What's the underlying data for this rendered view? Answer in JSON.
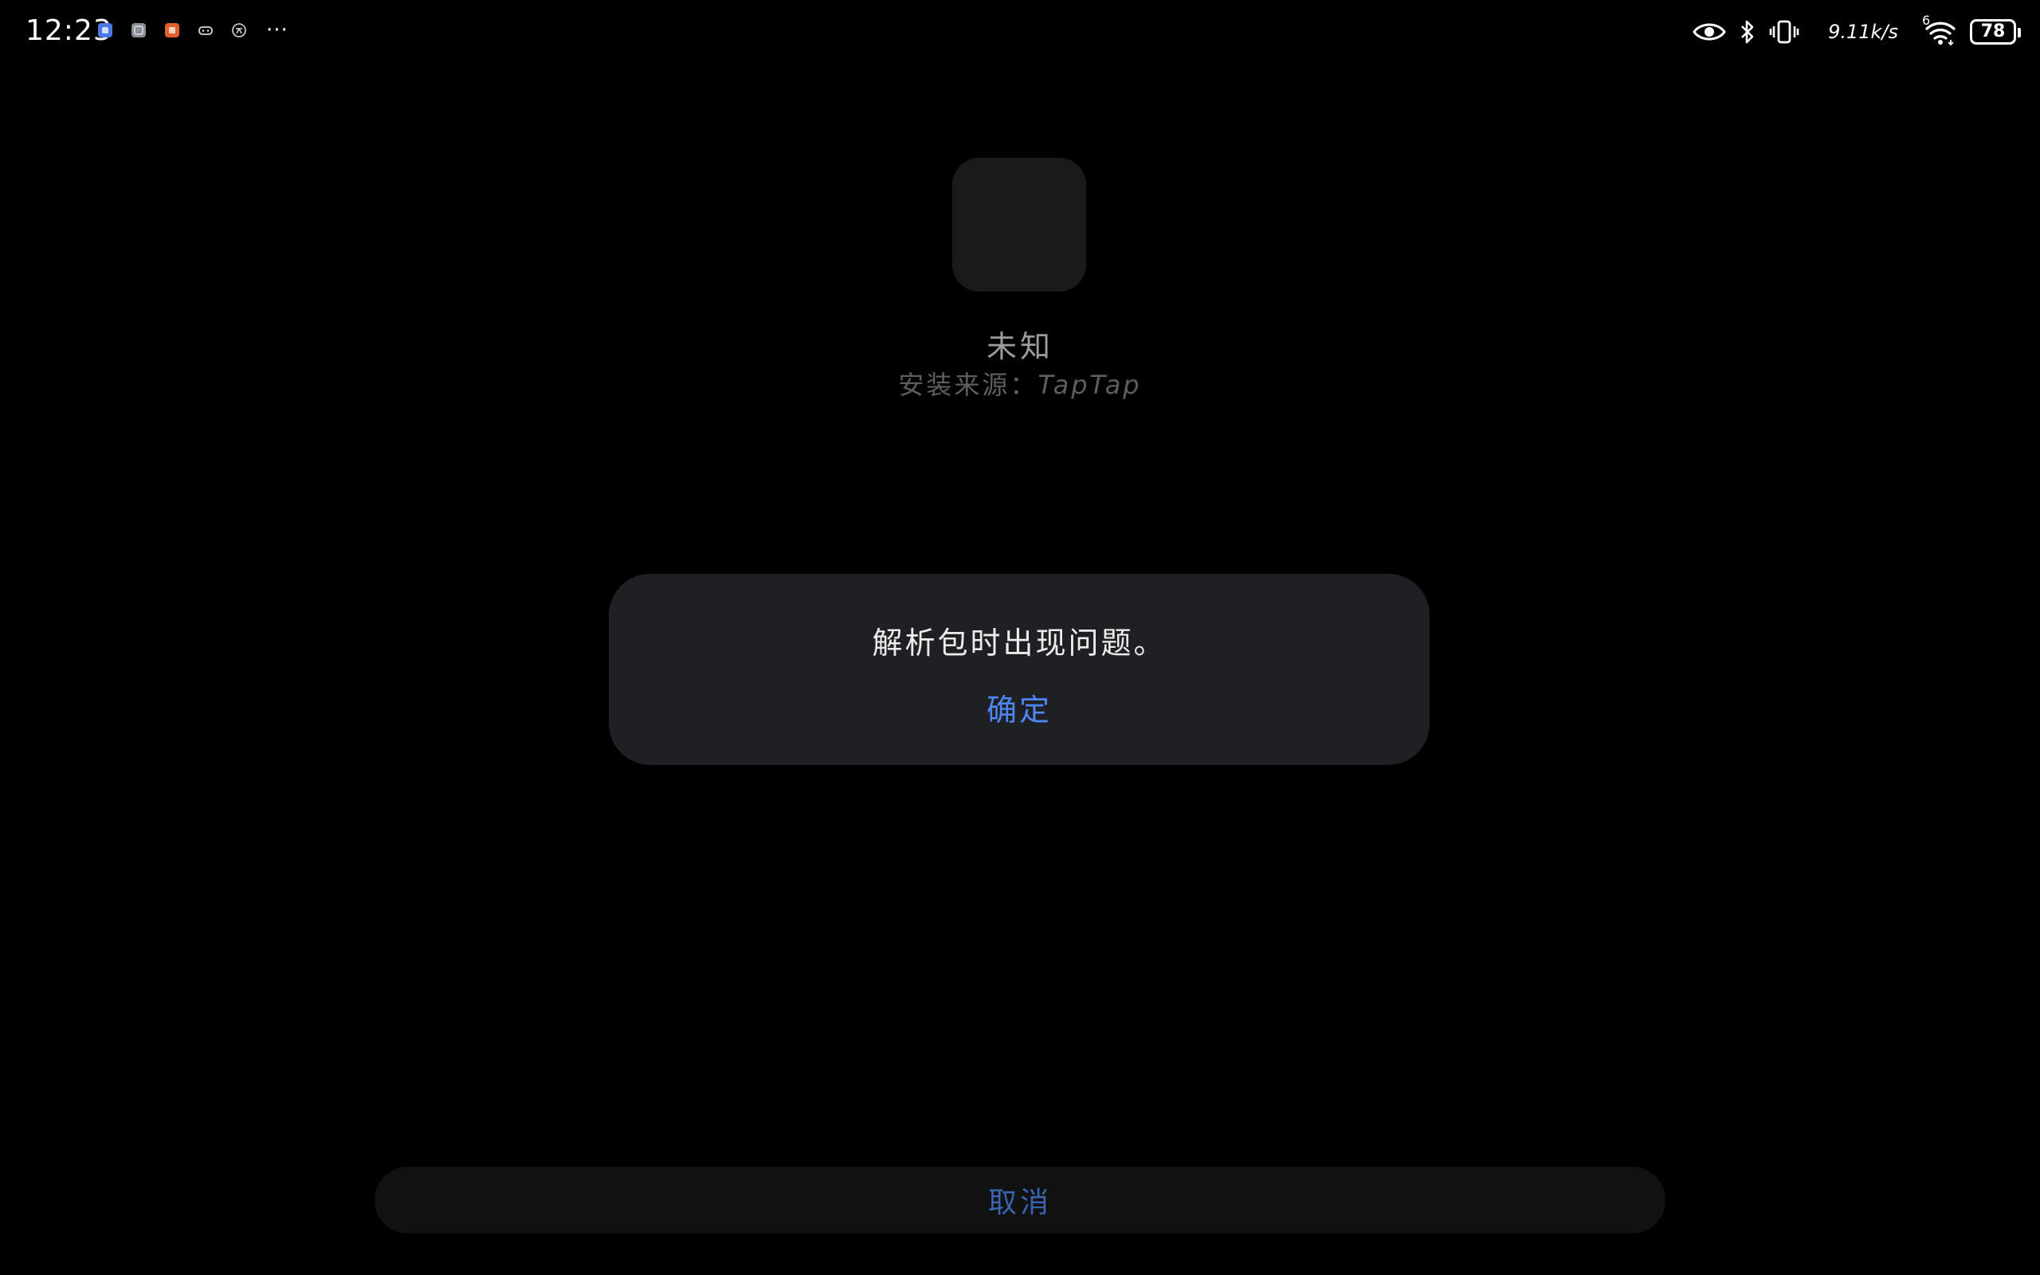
{
  "status_bar": {
    "time": "12:23",
    "notification_icons": [
      {
        "name": "app-notification-blue-icon",
        "color": "#4a78e6"
      },
      {
        "name": "app-notification-gray-icon",
        "color": "#8a8f99"
      },
      {
        "name": "app-notification-orange-icon",
        "color": "#e0612e"
      },
      {
        "name": "gamepad-icon",
        "color": "#d8d8d8"
      },
      {
        "name": "app-notification-round-icon",
        "color": "#d8d8d8"
      }
    ],
    "more_label": "···",
    "network_speed": "9.11k/s",
    "signal_label": "6",
    "battery_level": "78"
  },
  "app_info": {
    "name": "未知",
    "source_label": "安装来源：",
    "source_value": "TapTap"
  },
  "dialog": {
    "message": "解析包时出现问题。",
    "ok_label": "确定"
  },
  "footer": {
    "cancel_label": "取消"
  },
  "colors": {
    "background": "#000000",
    "dialog_bg": "#1f2023",
    "accent": "#4f86f7",
    "cancel_text": "#3a63b0"
  }
}
